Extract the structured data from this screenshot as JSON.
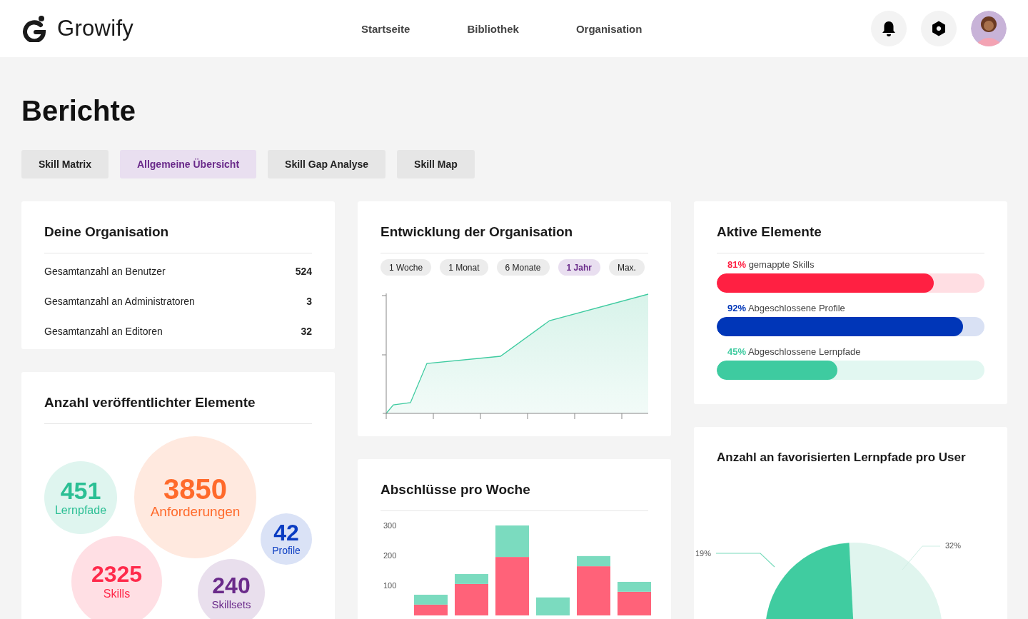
{
  "brand": {
    "name": "Growify"
  },
  "nav": [
    {
      "label": "Startseite"
    },
    {
      "label": "Bibliothek"
    },
    {
      "label": "Organisation"
    }
  ],
  "page_title": "Berichte",
  "tabs": [
    {
      "label": "Skill Matrix",
      "selected": false
    },
    {
      "label": "Allgemeine Übersicht",
      "selected": true
    },
    {
      "label": "Skill Gap Analyse",
      "selected": false
    },
    {
      "label": "Skill Map",
      "selected": false
    }
  ],
  "organisation": {
    "title": "Deine Organisation",
    "rows": [
      {
        "label": "Gesamtanzahl an Benutzer",
        "value": "524"
      },
      {
        "label": "Gesamtanzahl an Administratoren",
        "value": "3"
      },
      {
        "label": "Gesamtanzahl an Editoren",
        "value": "32"
      }
    ]
  },
  "published": {
    "title": "Anzahl veröffentlichter Elemente",
    "bubbles": [
      {
        "value": "451",
        "label": "Lernpfade",
        "color": "#2bbf94"
      },
      {
        "value": "3850",
        "label": "Anforderungen",
        "color": "#ff6a2b"
      },
      {
        "value": "42",
        "label": "Profile",
        "color": "#0a3cc2"
      },
      {
        "value": "2325",
        "label": "Skills",
        "color": "#ff2a4b"
      },
      {
        "value": "240",
        "label": "Skillsets",
        "color": "#6a2a8a"
      }
    ]
  },
  "development": {
    "title": "Entwicklung der Organisation",
    "ranges": [
      {
        "label": "1 Woche",
        "selected": false
      },
      {
        "label": "1 Monat",
        "selected": false
      },
      {
        "label": "6 Monate",
        "selected": false
      },
      {
        "label": "1 Jahr",
        "selected": true
      },
      {
        "label": "Max.",
        "selected": false
      }
    ]
  },
  "completions": {
    "title": "Abschlüsse pro Woche",
    "chart_data": {
      "type": "bar",
      "stacked": true,
      "ylim": [
        0,
        300
      ],
      "yticks": [
        100,
        200,
        300
      ],
      "series": [
        {
          "color": "#ff6279",
          "values": [
            36,
            105,
            195,
            0,
            164,
            79
          ]
        },
        {
          "color": "#7bdbbf",
          "values": [
            33,
            33,
            105,
            60,
            34,
            33
          ]
        }
      ]
    }
  },
  "active": {
    "title": "Aktive Elemente",
    "bars": [
      {
        "percent": "81%",
        "label": "gemappte Skills",
        "level": 0.81,
        "color": "#ff2042"
      },
      {
        "percent": "92%",
        "label": "Abgeschlossene Profile",
        "level": 0.92,
        "color": "#0036b8"
      },
      {
        "percent": "45%",
        "label": "Abgeschlossene Lernpfade",
        "level": 0.45,
        "color": "#3ecba0"
      }
    ]
  },
  "favorites": {
    "title": "Anzahl an favorisierten Lernpfade pro User",
    "slices": [
      {
        "label": "19%",
        "color": "#40cca0"
      },
      {
        "label": "32%",
        "color": "#e0f5ee"
      }
    ]
  }
}
